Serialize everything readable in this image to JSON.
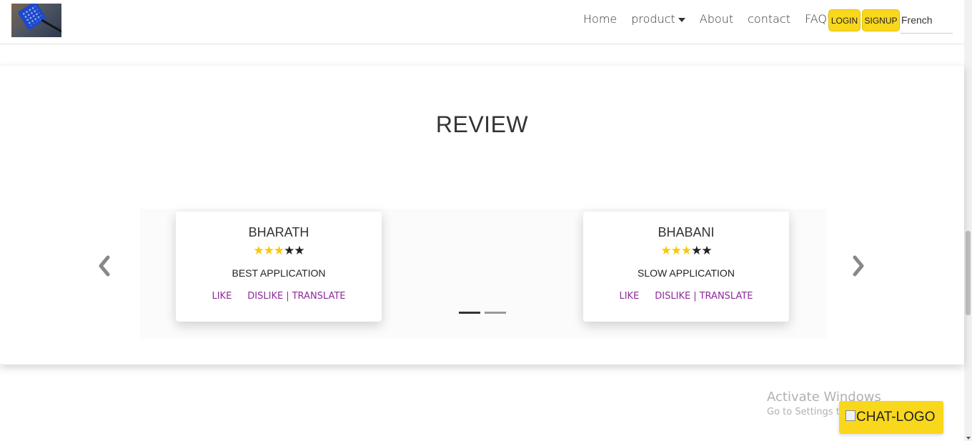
{
  "nav": {
    "home": "Home",
    "product": "product",
    "about": "About",
    "contact": "contact",
    "faq": "FAQ's",
    "login": "LOGIN",
    "signup": "SIGNUP",
    "language": "French"
  },
  "review": {
    "title": "REVIEW",
    "cards": [
      {
        "name": "BHARATH",
        "rating": 3,
        "max_rating": 5,
        "text": "BEST APPLICATION",
        "like": "LIKE",
        "dislike": "DISLIKE",
        "separator": "|",
        "translate": "TRANSLATE"
      },
      {
        "name": "BHABANI",
        "rating": 3,
        "max_rating": 5,
        "text": "SLOW APPLICATION",
        "like": "LIKE",
        "dislike": "DISLIKE",
        "separator": "|",
        "translate": "TRANSLATE"
      }
    ],
    "active_slide": 1,
    "slide_count": 2
  },
  "watermark": {
    "title": "Activate Windows",
    "subtitle": "Go to Settings to activate Windows."
  },
  "chat": {
    "label": "CHAT-LOGO"
  },
  "colors": {
    "accent_yellow": "#f9d71c",
    "star_yellow": "#f6c90e",
    "link_purple": "#8e2a9a"
  }
}
